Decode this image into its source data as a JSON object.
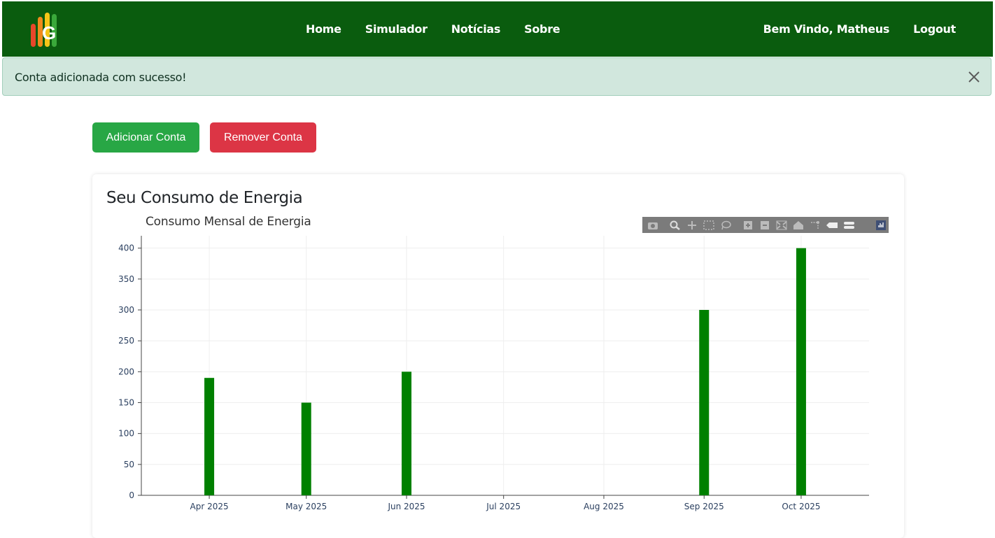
{
  "nav": {
    "links": [
      "Home",
      "Simulador",
      "Notícias",
      "Sobre"
    ],
    "welcome": "Bem Vindo, Matheus",
    "logout": "Logout"
  },
  "alert": {
    "message": "Conta adicionada com sucesso!"
  },
  "actions": {
    "add_label": "Adicionar Conta",
    "remove_label": "Remover Conta"
  },
  "card": {
    "title": "Seu Consumo de Energia"
  },
  "colors": {
    "navbar": "#0a5c0e",
    "bar": "#008000",
    "add_button": "#28a745",
    "remove_button": "#dc3545",
    "alert_bg": "#d1e7dd"
  },
  "modebar": {
    "icons": [
      "camera-icon",
      "zoom-icon",
      "pan-icon",
      "box-select-icon",
      "lasso-select-icon",
      "zoom-in-icon",
      "zoom-out-icon",
      "autoscale-icon",
      "reset-axes-icon",
      "spike-lines-icon",
      "hover-closest-icon",
      "hover-compare-icon",
      "plotly-logo-icon"
    ]
  },
  "chart_data": {
    "type": "bar",
    "title": "Consumo Mensal de Energia",
    "xlabel": "",
    "ylabel": "",
    "x_ticks": [
      "Apr 2025",
      "May 2025",
      "Jun 2025",
      "Jul 2025",
      "Aug 2025",
      "Sep 2025",
      "Oct 2025"
    ],
    "x": [
      "2025-04-01",
      "2025-05-01",
      "2025-06-01",
      "2025-09-01",
      "2025-10-01"
    ],
    "values": [
      190,
      150,
      200,
      300,
      400
    ],
    "ylim": [
      0,
      420
    ],
    "y_ticks": [
      0,
      50,
      100,
      150,
      200,
      250,
      300,
      350,
      400
    ],
    "grid": true,
    "legend": "none"
  }
}
